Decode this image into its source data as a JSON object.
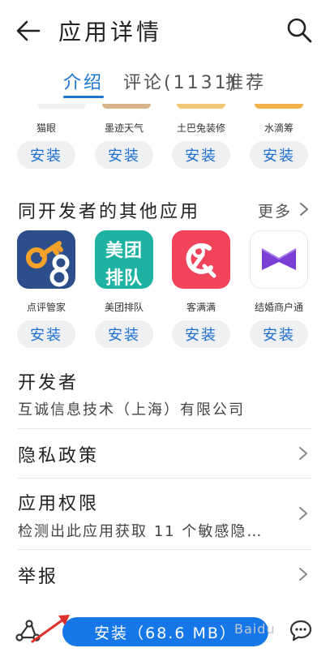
{
  "header": {
    "title": "应用详情"
  },
  "tabs": [
    {
      "label": "介绍"
    },
    {
      "label": "评论(1131)"
    },
    {
      "label": "推荐"
    }
  ],
  "top_apps": [
    {
      "name": "猫眼",
      "install_label": "安装"
    },
    {
      "name": "墨迹天气",
      "install_label": "安装"
    },
    {
      "name": "土巴兔装修",
      "install_label": "安装"
    },
    {
      "name": "水滴筹",
      "install_label": "安装"
    }
  ],
  "developer_apps_section": {
    "title": "同开发者的其他应用",
    "more_label": "更多"
  },
  "developer_apps": [
    {
      "name": "点评管家",
      "install_label": "安装"
    },
    {
      "name": "美团排队",
      "install_label": "安装",
      "icon_text_top": "美团",
      "icon_text_bottom": "排队"
    },
    {
      "name": "客满满",
      "install_label": "安装"
    },
    {
      "name": "结婚商户通",
      "install_label": "安装"
    }
  ],
  "developer": {
    "label": "开发者",
    "name": "互诚信息技术（上海）有限公司"
  },
  "privacy": {
    "label": "隐私政策"
  },
  "permissions": {
    "label": "应用权限",
    "detail": "检测出此应用获取 11 个敏感隐…"
  },
  "report": {
    "label": "举报"
  },
  "bottom": {
    "install_label": "安装（68.6 MB）",
    "watermark": "Baidu"
  },
  "colors": {
    "accent": "#1976d2",
    "install_button": "#1677e8",
    "arrow": "#e0302e"
  }
}
